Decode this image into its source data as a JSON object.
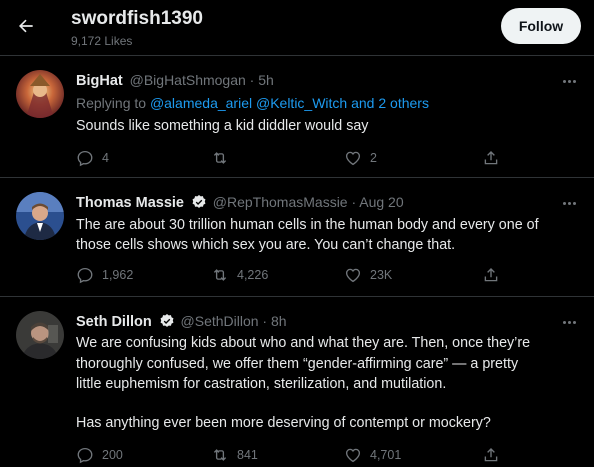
{
  "header": {
    "title": "swordfish1390",
    "subtitle": "9,172 Likes",
    "follow_label": "Follow"
  },
  "tweets": [
    {
      "name": "BigHat",
      "meta": "@BigHatShmogan · 5h",
      "replying_prefix": "Replying to ",
      "replying_user1": "@alameda_ariel",
      "replying_user2": "@Keltic_Witch",
      "replying_more": "and 2 others",
      "lines": [
        "Sounds like something a kid diddler would say"
      ],
      "reply_count": "4",
      "retweet_count": "",
      "like_count": "2"
    },
    {
      "name": "Thomas Massie",
      "meta": "@RepThomasMassie · Aug 20",
      "lines": [
        "The are about 30 trillion human cells in the human body and every one of",
        "those cells shows which sex you are. You can’t change that."
      ],
      "reply_count": "1,962",
      "retweet_count": "4,226",
      "like_count": "23K"
    },
    {
      "name": "Seth Dillon",
      "meta": "@SethDillon · 8h",
      "lines": [
        "We are confusing kids about who and what they are. Then, once they’re",
        "thoroughly confused, we offer them “gender-affirming care” — a pretty",
        "little euphemism for castration, sterilization, and mutilation.",
        "Has anything ever been more deserving of contempt or mockery?"
      ],
      "reply_count": "200",
      "retweet_count": "841",
      "like_count": "4,701"
    }
  ],
  "icons": {
    "back": "arrow-left-icon",
    "more": "more-dots-icon",
    "verified": "verified-badge-icon",
    "reply": "reply-icon",
    "retweet": "retweet-icon",
    "like": "heart-icon",
    "share": "share-icon"
  },
  "colors": {
    "background": "#000000",
    "text": "#e7e9ea",
    "muted": "#71767b",
    "link": "#1d9bf0",
    "divider": "#2f3336",
    "follow_bg": "#eff3f4"
  }
}
